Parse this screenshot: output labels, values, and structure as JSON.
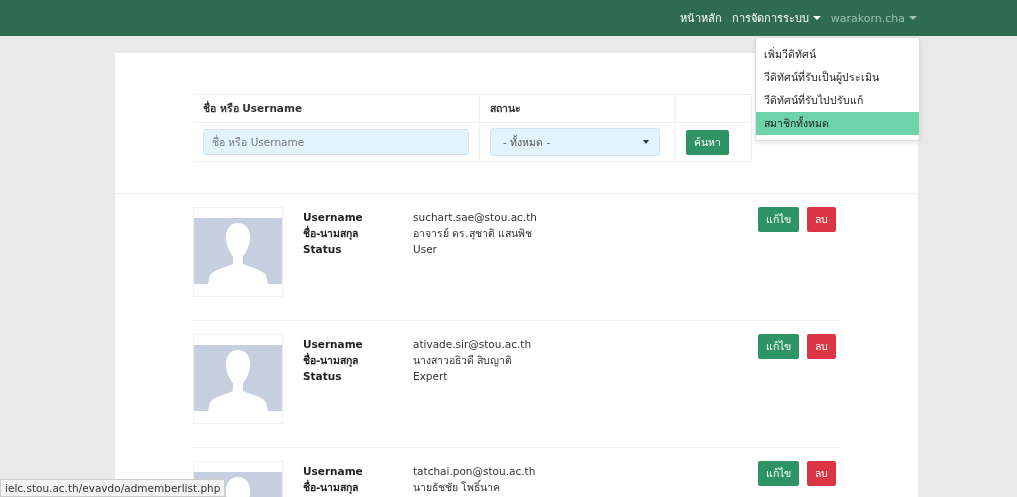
{
  "navbar": {
    "links": [
      {
        "label": "หน้าหลัก",
        "kind": "link"
      },
      {
        "label": "การจัดการระบบ",
        "kind": "dropdown"
      },
      {
        "label": "warakorn.cha",
        "kind": "user"
      }
    ]
  },
  "dropdown_menu": {
    "items": [
      {
        "label": "เพิ่มวีดิทัศน์",
        "selected": false
      },
      {
        "label": "วีดิทัศน์ที่รับเป็นผู้ประเมิน",
        "selected": false
      },
      {
        "label": "วีดิทัศน์ที่รับไปปรับแก้",
        "selected": false
      },
      {
        "label": "สมาชิกทั้งหมด",
        "selected": true
      }
    ]
  },
  "filter": {
    "name_label": "ชื่อ หรือ Username",
    "status_label": "สถานะ",
    "name_placeholder": "ชื่อ หรือ Username",
    "status_value": "- ทั้งหมด -",
    "search_button": "ค้นหา"
  },
  "members": [
    {
      "fields": [
        {
          "label": "Username",
          "value": "suchart.sae@stou.ac.th"
        },
        {
          "label": "ชื่อ-นามสกุล",
          "value": "อาจารย์ ดร.สุชาติ แสนพิช"
        },
        {
          "label": "Status",
          "value": "User"
        }
      ],
      "edit": "แก้ไข",
      "delete": "ลบ"
    },
    {
      "fields": [
        {
          "label": "Username",
          "value": "ativade.sir@stou.ac.th"
        },
        {
          "label": "ชื่อ-นามสกุล",
          "value": "นางสาวอธิวดี สิบญาติ"
        },
        {
          "label": "Status",
          "value": "Expert"
        }
      ],
      "edit": "แก้ไข",
      "delete": "ลบ"
    },
    {
      "fields": [
        {
          "label": "Username",
          "value": "tatchai.pon@stou.ac.th"
        },
        {
          "label": "ชื่อ-นามสกุล",
          "value": "นายธัชชัย โพธิ์นาค"
        }
      ],
      "edit": "แก้ไข",
      "delete": "ลบ"
    }
  ],
  "status_bar": {
    "url": "ielc.stou.ac.th/evavdo/admemberlist.php"
  }
}
